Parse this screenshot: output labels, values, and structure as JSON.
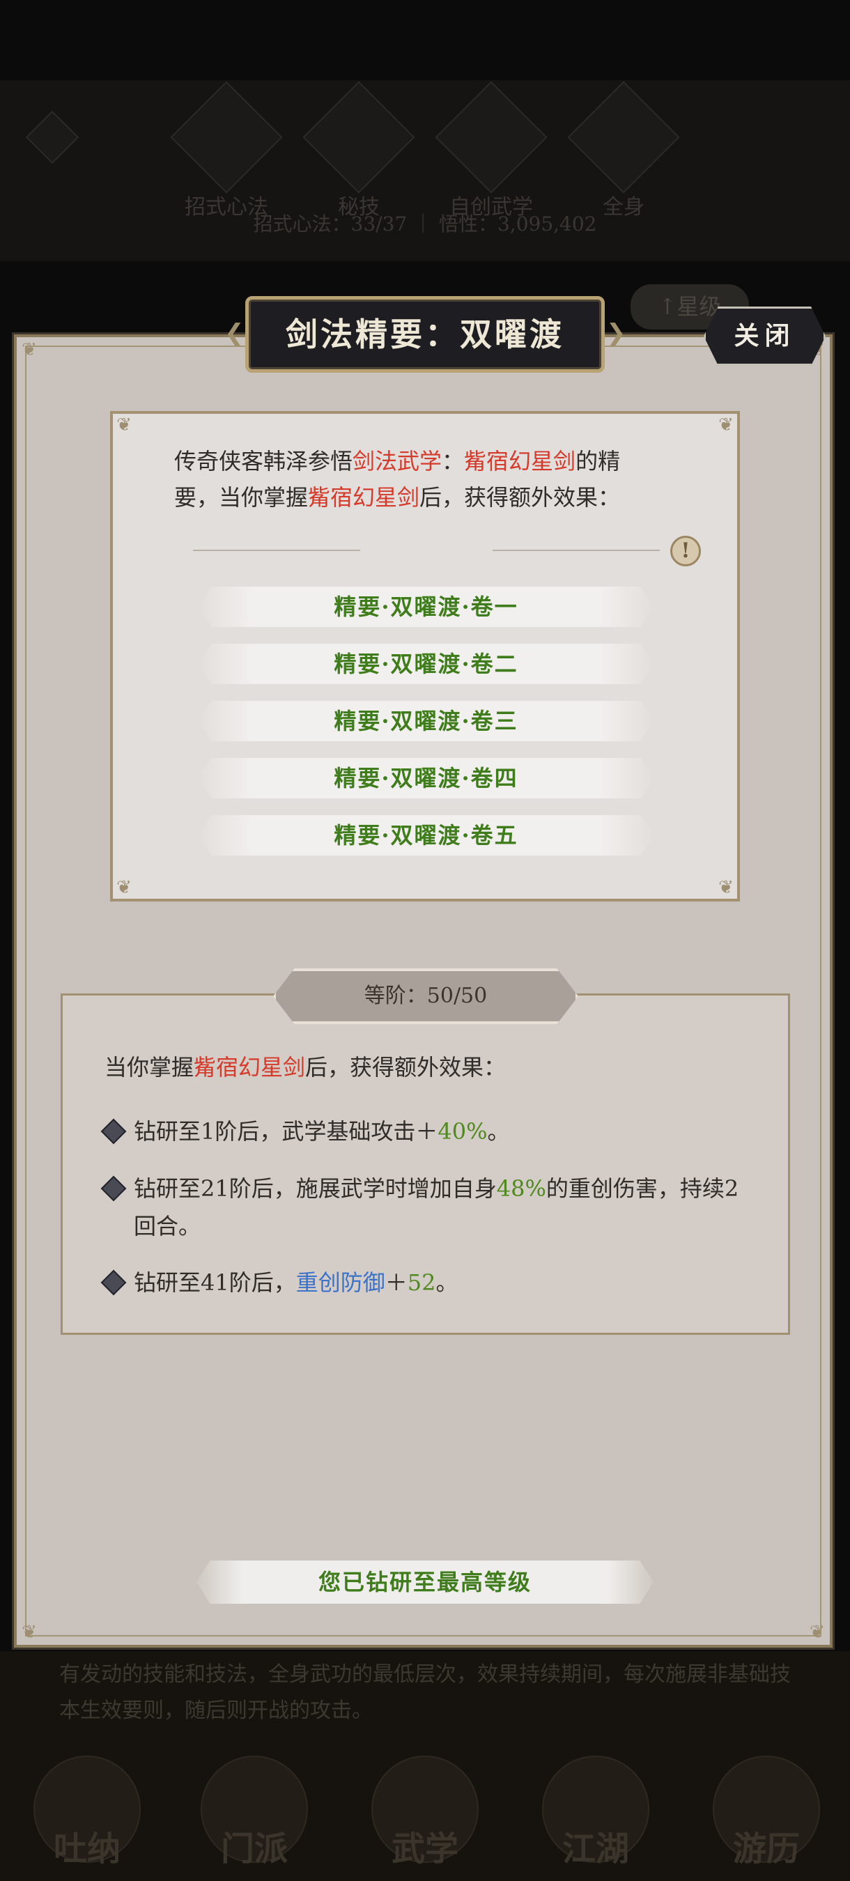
{
  "background": {
    "nav_items": [
      {
        "label": "招式心法",
        "icon": "sword-icon"
      },
      {
        "label": "秘技",
        "icon": "book-icon"
      },
      {
        "label": "自创武学",
        "icon": "scroll-icon"
      },
      {
        "label": "全身",
        "icon": "meditation-icon"
      }
    ],
    "stats_text": "招式心法：33/37 ｜ 悟性：3,095,402",
    "side_button": "↑星级",
    "lower_text": "有发动的技能和技法，全身武功的最低层次，效果持续期间，每次施展非基础技本生效要则，随后则开战的攻击。",
    "bottom_tabs": [
      "吐纳",
      "门派",
      "武学",
      "江湖",
      "游历"
    ]
  },
  "panel": {
    "title": "剑法精要：双曜渡",
    "close_label": "关闭"
  },
  "card": {
    "desc_parts": {
      "p1": "传奇侠客韩泽参悟",
      "p2": "剑法武学",
      "p3": "：",
      "p4": "觜宿幻星剑",
      "p5": "的精要，当你掌握",
      "p6": "觜宿幻星剑",
      "p7": "后，获得额外效果："
    },
    "info_icon": "!",
    "volumes": [
      "精要·双曜渡·卷一",
      "精要·双曜渡·卷二",
      "精要·双曜渡·卷三",
      "精要·双曜渡·卷四",
      "精要·双曜渡·卷五"
    ]
  },
  "rank": {
    "badge_label": "等阶：",
    "badge_value": "50/50",
    "heading_p1": "当你掌握",
    "heading_p2": "觜宿幻星剑",
    "heading_p3": "后，获得额外效果：",
    "effects": [
      {
        "p1": "钻研至1阶后，武学基础攻击＋",
        "p2": "40%",
        "p3": "。"
      },
      {
        "p1": "钻研至21阶后，施展武学时增加自身",
        "p2": "48%",
        "p3": "的重创伤害，持续2回合。"
      },
      {
        "p1": "钻研至41阶后，",
        "p2": "重创防御",
        "p3": "＋",
        "p4": "52",
        "p5": "。"
      }
    ]
  },
  "max_level_label": "您已钻研至最高等级"
}
